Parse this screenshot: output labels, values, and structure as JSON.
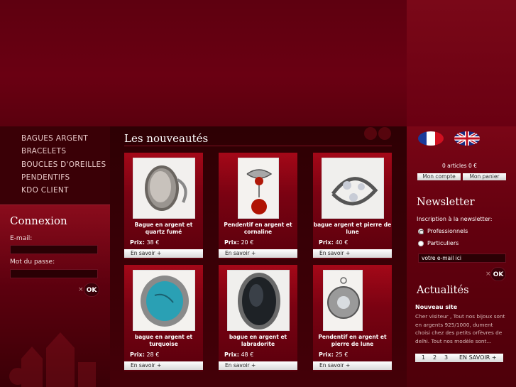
{
  "nav": [
    "BAGUES ARGENT",
    "BRACELETS",
    "BOUCLES D'OREILLES",
    "PENDENTIFS",
    "KDO CLIENT"
  ],
  "login": {
    "title": "Connexion",
    "email_label": "E-mail:",
    "password_label": "Mot du passe:",
    "ok": "OK",
    "x": "×"
  },
  "main": {
    "title": "Les nouveautés",
    "price_label": "Prix:",
    "more_label": "En savoir +"
  },
  "products": [
    {
      "name": "Bague en argent et quartz fumé",
      "price": "38 €"
    },
    {
      "name": "Pendentif en argent et cornaline",
      "price": "20 €"
    },
    {
      "name": "bague argent et pierre de lune",
      "price": "40 €"
    },
    {
      "name": "bague en argent et turquoise",
      "price": "28 €"
    },
    {
      "name": "bague en argent et labradorite",
      "price": "48 €"
    },
    {
      "name": "Pendentif en argent et pierre de lune",
      "price": "25 €"
    }
  ],
  "cart": {
    "summary": "0 articles   0 €",
    "account": "Mon compte",
    "basket": "Mon panier"
  },
  "newsletter": {
    "title": "Newsletter",
    "prompt": "Inscription à la newsletter:",
    "option_pro": "Professionnels",
    "option_part": "Particuliers",
    "placeholder": "votre e-mail ici",
    "ok": "OK",
    "x": "×"
  },
  "news": {
    "title": "Actualités",
    "headline": "Nouveau site",
    "body": "Cher visiteur , Tout nos bijoux sont en argents 925/1000, dument choisi chez des petits orfèvres de delhi. Tout nos modèle sont...",
    "pages": [
      "1",
      "2",
      "3"
    ],
    "more": "EN SAVOIR +"
  }
}
